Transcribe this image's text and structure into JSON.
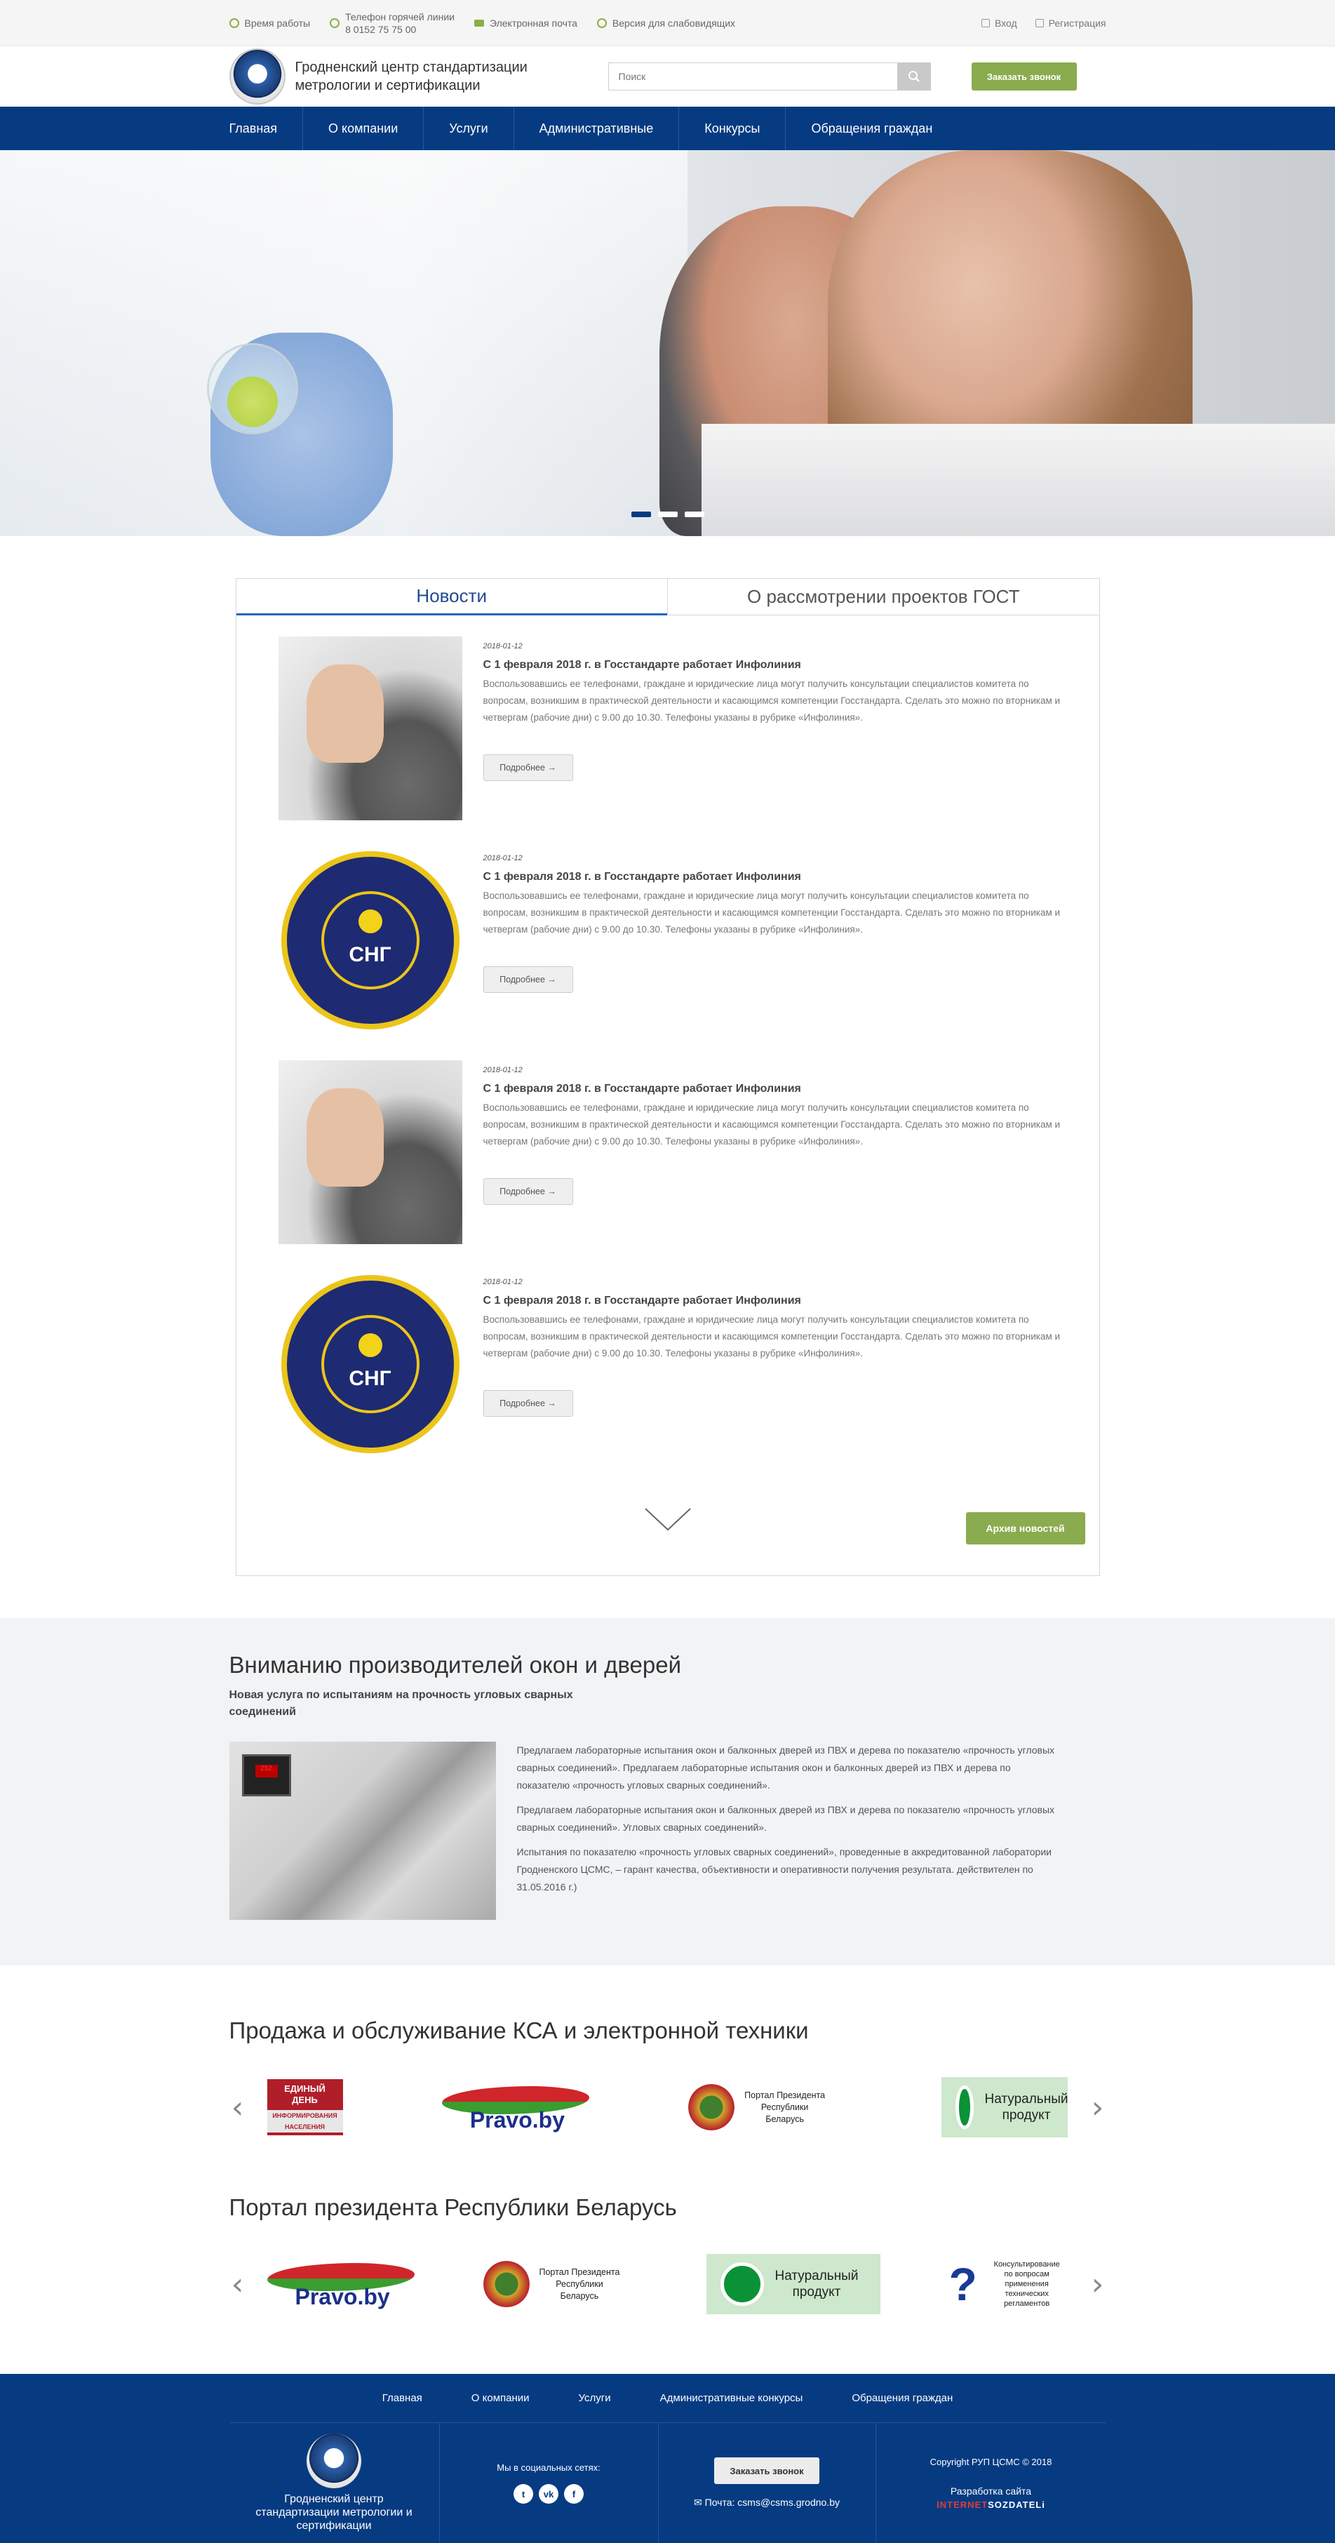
{
  "topbar": {
    "items": [
      {
        "label": "Время работы",
        "icon": "clock-icon"
      },
      {
        "label": "Телефон горячей линии",
        "value": "8 0152 75 75 00",
        "icon": "phone-icon"
      },
      {
        "label": "Электронная почта",
        "icon": "mail-icon"
      },
      {
        "label": "Версия для слабовидящих",
        "icon": "eye-icon"
      }
    ],
    "login": "Вход",
    "register": "Регистрация"
  },
  "header": {
    "org_line1": "Гродненский центр стандартизации",
    "org_line2": "метрологии и сертификации",
    "search_placeholder": "Поиск",
    "call_button": "Заказать звонок"
  },
  "nav": [
    "Главная",
    "О компании",
    "Услуги",
    "Административные",
    "Конкурсы",
    "Обращения граждан"
  ],
  "hero": {
    "slides": 3,
    "active_slide": 1
  },
  "news": {
    "tabs": [
      "Новости",
      "О рассмотрении проектов ГОСТ"
    ],
    "active_tab": 0,
    "items": [
      {
        "date": "2018-01-12",
        "title": "С 1 февраля 2018 г. в Госстандарте работает Инфолиния",
        "text": "Воспользовавшись ее телефонами, граждане и юридические лица могут получить консультации специалистов комитета по вопросам, возникшим в практической деятельности и касающимся компетенции Госстандарта. Сделать это можно по вторникам и четвергам (рабочие дни) с 9.00 до 10.30. Телефоны указаны в рубрике «Инфолиния».",
        "image": "phone-keypad",
        "more": "Подробнее →"
      },
      {
        "date": "2018-01-12",
        "title": "С 1 февраля 2018 г. в Госстандарте работает Инфолиния",
        "text": "Воспользовавшись ее телефонами, граждане и юридические лица могут получить консультации специалистов комитета по вопросам, возникшим в практической деятельности и касающимся компетенции Госстандарта. Сделать это можно по вторникам и четвергам (рабочие дни) с 9.00 до 10.30. Телефоны указаны в рубрике «Инфолиния».",
        "image": "sng-medal",
        "more": "Подробнее →"
      },
      {
        "date": "2018-01-12",
        "title": "С 1 февраля 2018 г. в Госстандарте работает Инфолиния",
        "text": "Воспользовавшись ее телефонами, граждане и юридические лица могут получить консультации специалистов комитета по вопросам, возникшим в практической деятельности и касающимся компетенции Госстандарта. Сделать это можно по вторникам и четвергам (рабочие дни) с 9.00 до 10.30. Телефоны указаны в рубрике «Инфолиния».",
        "image": "phone-keypad",
        "more": "Подробнее →"
      },
      {
        "date": "2018-01-12",
        "title": "С 1 февраля 2018 г. в Госстандарте работает Инфолиния",
        "text": "Воспользовавшись ее телефонами, граждане и юридические лица могут получить консультации специалистов комитета по вопросам, возникшим в практической деятельности и касающимся компетенции Госстандарта. Сделать это можно по вторникам и четвергам (рабочие дни) с 9.00 до 10.30. Телефоны указаны в рубрике «Инфолиния».",
        "image": "sng-medal",
        "more": "Подробнее →"
      }
    ],
    "sng_label": "СНГ",
    "archive_button": "Архив новостей"
  },
  "windows": {
    "title": "Вниманию производителей окон и дверей",
    "subtitle": "Новая услуга по испытаниям на прочность угловых сварных соединений",
    "paragraphs": [
      "Предлагаем лабораторные испытания окон и балконных дверей из ПВХ и дерева по показателю «прочность угловых сварных соединений». Предлагаем лабораторные испытания окон и балконных дверей из ПВХ и дерева по показателю «прочность угловых сварных соединений».",
      "Предлагаем лабораторные испытания окон и балконных дверей из ПВХ и дерева по показателю «прочность угловых сварных соединений». Угловых сварных соединений».",
      "Испытания по показателю «прочность угловых сварных соединений», проведенные в аккредитованной лаборатории Гродненского ЦСМС, – гарант качества, объективности и оперативности получения результата. действителен по 31.05.2016 г.)"
    ]
  },
  "carousel1": {
    "title": "Продажа и обслуживание КСА и электронной техники",
    "day_banner": [
      "ЕДИНЫЙ",
      "ДЕНЬ",
      "ИНФОРМИРОВАНИЯ НАСЕЛЕНИЯ"
    ],
    "pravo": "Pravo.by",
    "portal": [
      "Портал Президента",
      "Республики",
      "Беларусь"
    ],
    "natural": [
      "Натуральный",
      "продукт"
    ]
  },
  "carousel2": {
    "title": "Портал президента Республики Беларусь",
    "pravo": "Pravo.by",
    "portal": [
      "Портал Президента",
      "Республики",
      "Беларусь"
    ],
    "natural": [
      "Натуральный",
      "продукт"
    ],
    "question": [
      "Консультирование",
      "по вопросам применения",
      "технических регламентов"
    ]
  },
  "footer": {
    "nav": [
      "Главная",
      "О компании",
      "Услуги",
      "Административные конкурсы",
      "Обращения граждан"
    ],
    "org": "Гродненский центр стандартизации метрологии и сертификации",
    "social_label": "Мы в социальных сетях:",
    "socials": [
      "twitter",
      "vk",
      "facebook"
    ],
    "call_button": "Заказать звонок",
    "email_label": "Почта: csms@csms.grodno.by",
    "copyright": "Copyright РУП ЦСМС © 2018",
    "dev_label": "Разработка сайта",
    "dev_brand_red": "INTERNET",
    "dev_brand_white": "SOZDATELi"
  }
}
